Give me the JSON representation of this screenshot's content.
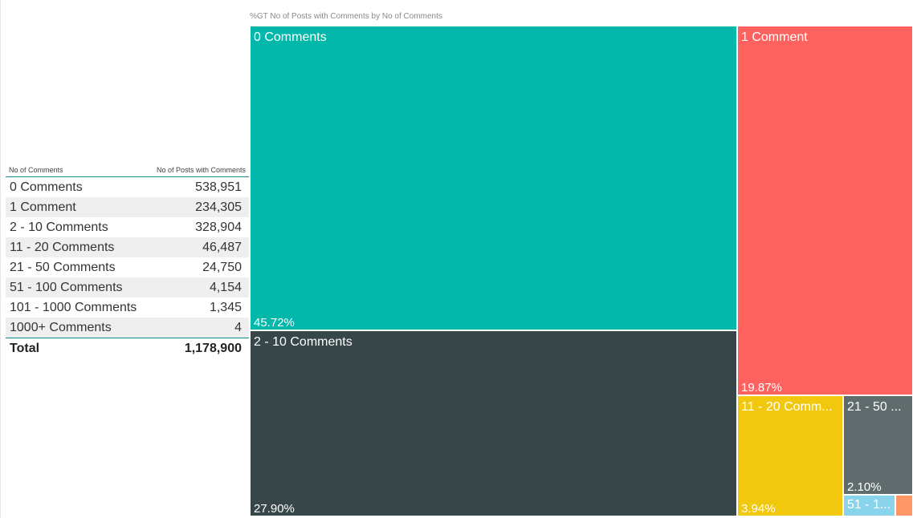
{
  "table": {
    "col1_header": "No of Comments",
    "col2_header": "No of Posts with Comments",
    "rows": [
      {
        "label": "0 Comments",
        "value": "538,951"
      },
      {
        "label": "1 Comment",
        "value": "234,305"
      },
      {
        "label": "2 - 10 Comments",
        "value": "328,904"
      },
      {
        "label": "11 - 20 Comments",
        "value": "46,487"
      },
      {
        "label": "21 - 50 Comments",
        "value": "24,750"
      },
      {
        "label": "51 - 100 Comments",
        "value": "4,154"
      },
      {
        "label": "101 - 1000 Comments",
        "value": "1,345"
      },
      {
        "label": "1000+ Comments",
        "value": "4"
      }
    ],
    "total_label": "Total",
    "total_value": "1,178,900"
  },
  "treemap": {
    "title": "%GT No of Posts with Comments by No of Comments"
  },
  "chart_data": {
    "type": "treemap",
    "title": "%GT No of Posts with Comments by No of Comments",
    "items": [
      {
        "name": "0 Comments",
        "label": "0 Comments",
        "value": 538951,
        "percent": "45.72%",
        "color": "#01b8aa"
      },
      {
        "name": "1 Comment",
        "label": "1 Comment",
        "value": 234305,
        "percent": "19.87%",
        "color": "#fd625e"
      },
      {
        "name": "2 - 10 Comments",
        "label": "2 - 10 Comments",
        "value": 328904,
        "percent": "27.90%",
        "color": "#374649"
      },
      {
        "name": "11 - 20 Comments",
        "label": "11 - 20 Comm...",
        "value": 46487,
        "percent": "3.94%",
        "color": "#f2c80f"
      },
      {
        "name": "21 - 50 Comments",
        "label": "21 - 50 ...",
        "value": 24750,
        "percent": "2.10%",
        "color": "#5f6b6d"
      },
      {
        "name": "51 - 100 Comments",
        "label": "51 - 1...",
        "value": 4154,
        "percent": "",
        "color": "#8ad4eb"
      },
      {
        "name": "101 - 1000 Comments",
        "label": "",
        "value": 1345,
        "percent": "",
        "color": "#fe9666"
      }
    ]
  }
}
